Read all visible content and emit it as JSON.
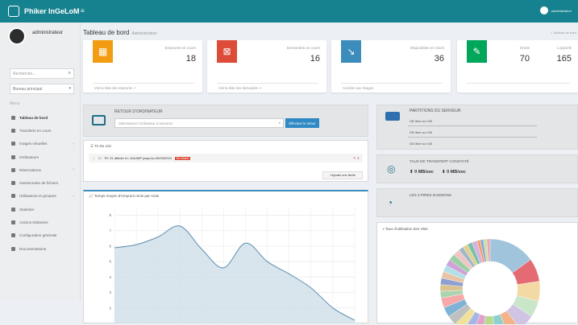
{
  "header": {
    "brand": "Phiker InGeLoM",
    "toggle": "≡",
    "user": "administrateur"
  },
  "sidebar": {
    "username": "administrateur",
    "search_placeholder": "Recherche...",
    "select_value": "Bureau principal",
    "menu_header": "Menu",
    "items": [
      {
        "label": "Tableau de bord",
        "active": true
      },
      {
        "label": "Transferts en cours"
      },
      {
        "label": "Images virtuelles",
        "chevron": true
      },
      {
        "label": "Ordinateurs"
      },
      {
        "label": "Réservations",
        "chevron": true
      },
      {
        "label": "Gestionnaire de fichiers"
      },
      {
        "label": "Utilisateurs et groupes",
        "chevron": true
      },
      {
        "label": "Statistics"
      },
      {
        "label": "Actions Distantes"
      },
      {
        "label": "Configuration générale"
      },
      {
        "label": "Documentations"
      }
    ]
  },
  "page": {
    "title": "Tableau de bord",
    "subtitle": "Administration",
    "breadcrumb": "Tableau de bord"
  },
  "stats": [
    {
      "label": "Emprunts en cours",
      "value": "18",
      "link": "Voir la liste des emprunts",
      "color": "#f39c12",
      "icon": "calendar-icon"
    },
    {
      "label": "Demandes en cours",
      "value": "16",
      "link": "Voir la liste des demandes",
      "color": "#dd4b39",
      "icon": "calendar-x-icon"
    },
    {
      "label": "Disponibles en stock",
      "value": "36",
      "link": "Accéder aux Images",
      "color": "#3c8dbc",
      "icon": "chart-down-icon"
    },
    {
      "label": "Droits",
      "value": "70",
      "link": "",
      "color": "#00a65a",
      "icon": "wrench-icon"
    },
    {
      "label": "Logiciels",
      "value": "165",
      "link": "",
      "color": "",
      "icon": ""
    }
  ],
  "retour": {
    "title": "RETOUR D'ORDINATEUR",
    "placeholder": "Sélectionnez l'ordinateur à retourner",
    "button": "Effectuer le retour"
  },
  "todo": {
    "title": "To Do List",
    "item": "PC 31 affecté à L.DAUMP jusqu'au 05/09/2024",
    "badge": "En retard",
    "add": "Ajouter une tâche"
  },
  "chart": {
    "title": "Temps moyen d'emprunt mois par mois"
  },
  "chart_data": [
    {
      "type": "area",
      "title": "Temps moyen d'emprunt mois par mois",
      "yticks": [
        "8",
        "7",
        "6",
        "5",
        "4",
        "3",
        "2"
      ],
      "ylim": [
        1,
        8.5
      ],
      "x": [
        0,
        1,
        2,
        3,
        4,
        5,
        6,
        7,
        8,
        9,
        10,
        11
      ],
      "values": [
        5.9,
        6.1,
        6.6,
        7.3,
        5.8,
        4.6,
        6.2,
        5.0,
        4.2,
        3.3,
        2.0,
        1.2
      ],
      "color": "#5c8fb0"
    }
  ],
  "partitions": {
    "title": "PARTITIONS DU SERVEUR",
    "rows": [
      "GB libre sur GB",
      "GB libre sur GB",
      "GB libre sur GB"
    ]
  },
  "transfer": {
    "title": "TAUX DE TRANSFERT CONSTATÉ",
    "up": "0 MB/sec",
    "down": "0 MB/sec"
  },
  "daemons": {
    "title": "LES 3 PIRES DAEMONS"
  },
  "vm": {
    "title": "Taux d'utilisation des VMs"
  }
}
